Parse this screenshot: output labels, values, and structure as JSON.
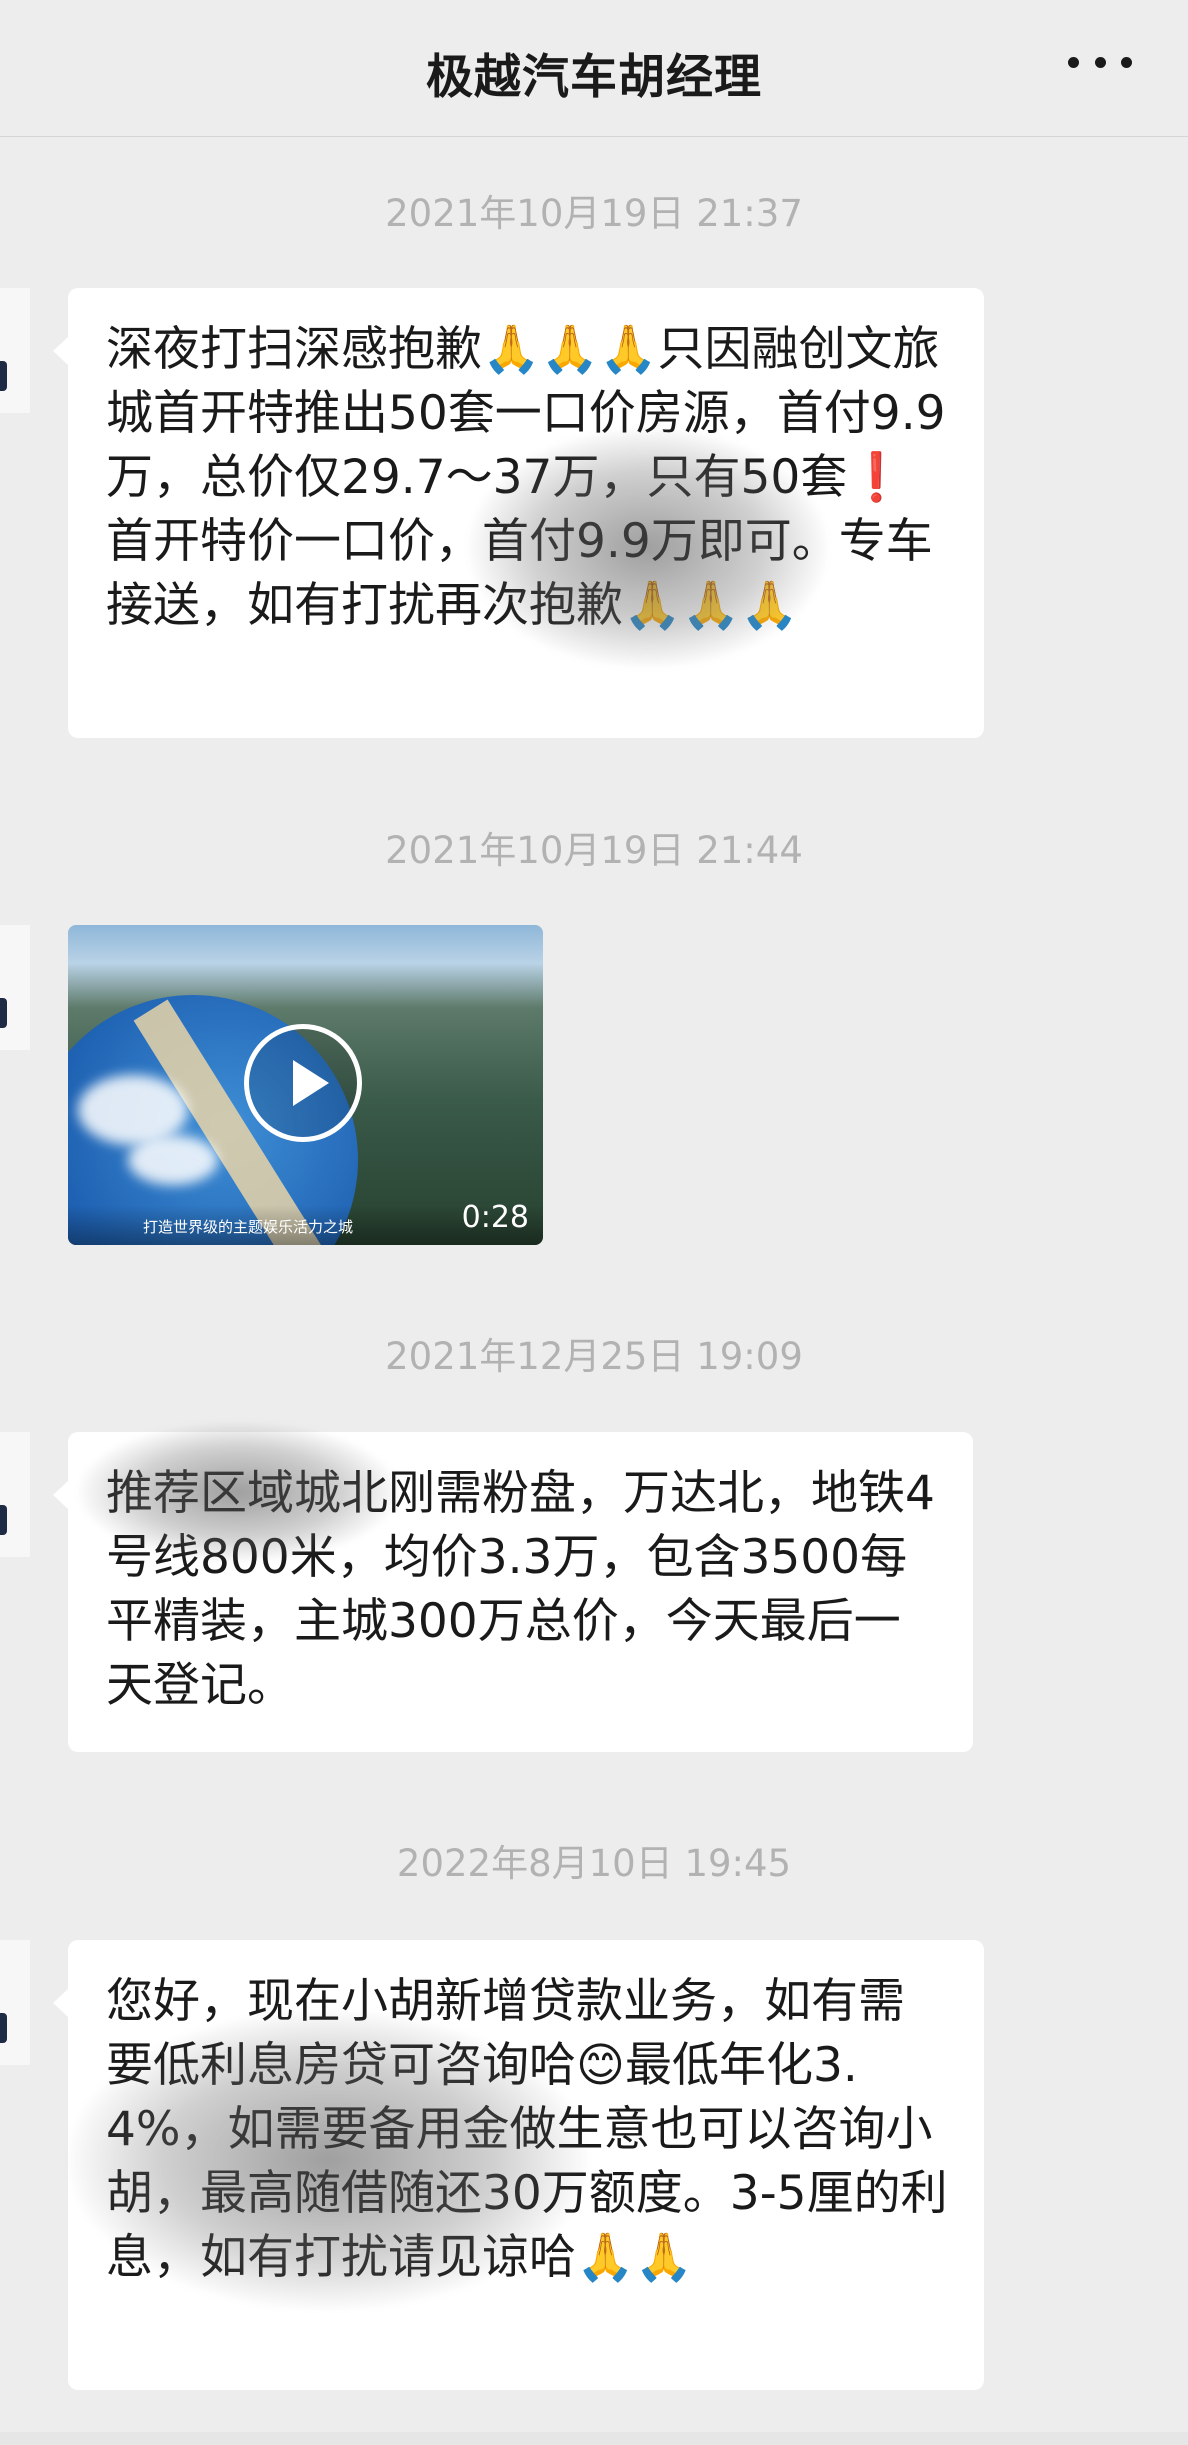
{
  "header": {
    "title": "极越汽车胡经理",
    "more_icon": "more-dots-icon"
  },
  "messages": [
    {
      "timestamp": "2021年10月19日 21:37",
      "text": "深夜打扫深感抱歉🙏🙏🙏只因融创文旅城首开特推出50套一口价房源，首付9.9万，总价仅29.7～37万，只有50套❗首开特价一口价，首付9.9万即可。专车接送，如有打扰再次抱歉🙏🙏🙏"
    },
    {
      "timestamp": "2021年10月19日 21:44",
      "video": {
        "caption": "打造世界级的主题娱乐活力之城",
        "duration": "0:28",
        "play_icon": "play-icon"
      }
    },
    {
      "timestamp": "2021年12月25日 19:09",
      "text": "推荐区域城北刚需粉盘，万达北，地铁4号线800米，均价3.3万，包含3500每平精装，主城300万总价，今天最后一天登记。"
    },
    {
      "timestamp": "2022年8月10日 19:45",
      "text": "您好，现在小胡新增贷款业务，如有需要低利息房贷可咨询哈😊最低年化3.4%，如需要备用金做生意也可以咨询小胡，最高随借随还30万额度。3-5厘的利息，如有打扰请见谅哈🙏🙏"
    }
  ]
}
